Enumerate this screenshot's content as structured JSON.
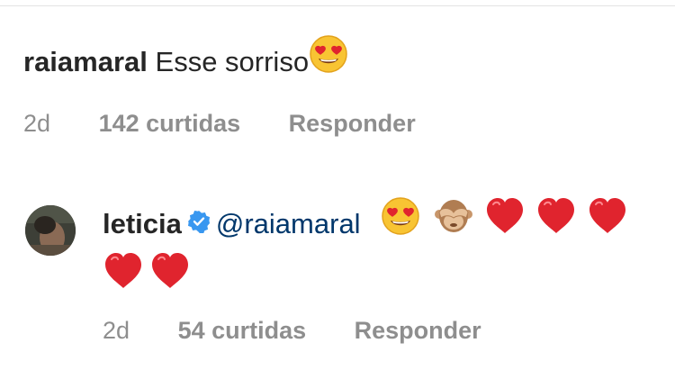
{
  "comments": [
    {
      "username": "raiamaral",
      "text": "Esse sorriso",
      "time": "2d",
      "likes": "142 curtidas",
      "reply": "Responder",
      "emoji": [
        "heart-eyes"
      ]
    },
    {
      "username": "leticia",
      "verified": true,
      "mention": "@raiamaral",
      "time": "2d",
      "likes": "54 curtidas",
      "reply": "Responder",
      "emoji": [
        "heart-eyes",
        "see-no-evil-monkey",
        "red-heart",
        "red-heart",
        "red-heart",
        "red-heart",
        "red-heart"
      ]
    }
  ],
  "colors": {
    "username": "#262626",
    "meta": "#8e8e8e",
    "mention": "#00376b",
    "verified": "#3897f0",
    "heart": "#e0242e",
    "emoji_face": "#f8c433"
  }
}
